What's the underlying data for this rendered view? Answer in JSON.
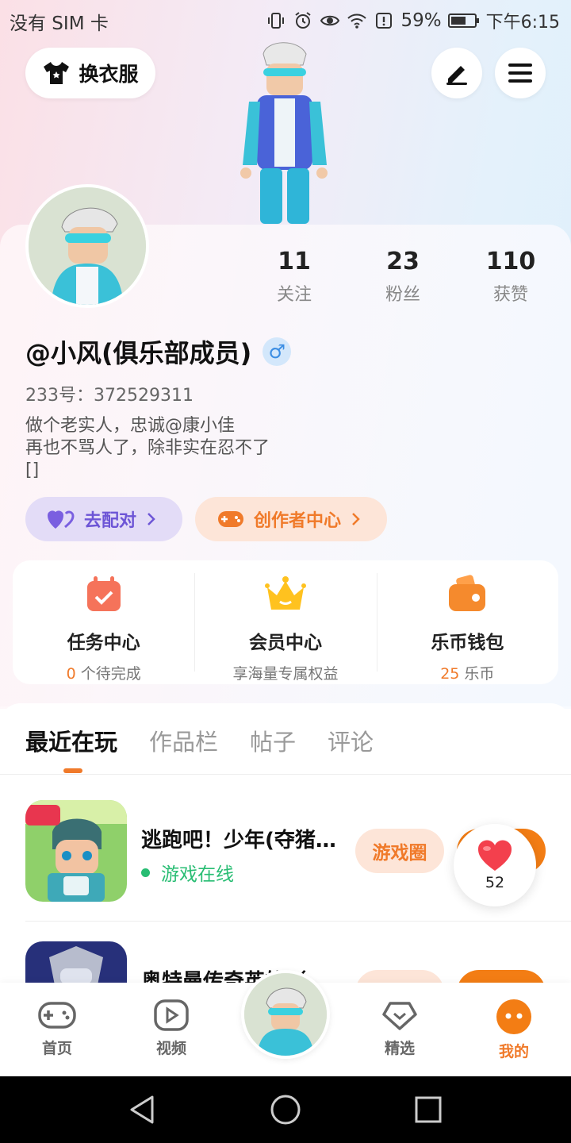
{
  "status_bar": {
    "carrier": "没有 SIM 卡",
    "battery": "59%",
    "time": "下午6:15"
  },
  "header": {
    "dress_label": "换衣服"
  },
  "profile": {
    "stats": [
      {
        "value": "11",
        "label": "关注"
      },
      {
        "value": "23",
        "label": "粉丝"
      },
      {
        "value": "110",
        "label": "获赞"
      }
    ],
    "nickname": "@小风(俱乐部成员)",
    "gender_symbol": "♂",
    "uid": "233号：372529311",
    "bio_lines": [
      "做个老实人，忠诚@康小佳",
      "再也不骂人了，除非实在忍不了",
      "[]"
    ]
  },
  "pills": {
    "match": "去配对",
    "creator": "创作者中心"
  },
  "quick_cards": [
    {
      "title": "任务中心",
      "highlight": "0",
      "sub": " 个待完成"
    },
    {
      "title": "会员中心",
      "highlight": "",
      "sub": "享海量专属权益"
    },
    {
      "title": "乐币钱包",
      "highlight": "25",
      "sub": " 乐币"
    }
  ],
  "tabs": [
    "最近在玩",
    "作品栏",
    "帖子",
    "评论"
  ],
  "games": [
    {
      "title": "逃跑吧！少年(夺猪…",
      "status": "游戏在线",
      "circle_label": "游戏圈"
    },
    {
      "title": "奥特曼传奇英雄（…",
      "status": "",
      "circle_label": ""
    }
  ],
  "like_count": "52",
  "bottom_nav": [
    {
      "label": "首页",
      "icon": "gamepad-icon"
    },
    {
      "label": "视频",
      "icon": "video-icon"
    },
    {
      "label": "精选",
      "icon": "heart-badge-icon"
    },
    {
      "label": "我的",
      "icon": "profile-face-icon"
    }
  ],
  "colors": {
    "accent": "#f07a2a",
    "purple": "#6d55d6",
    "online_green": "#28bd73"
  }
}
